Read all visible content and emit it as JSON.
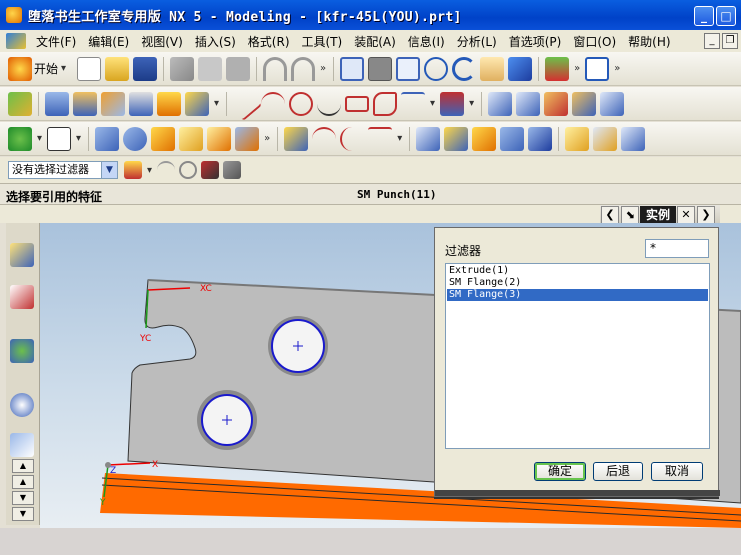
{
  "window": {
    "title": "堕落书生工作室专用版 NX 5 - Modeling - [kfr-45L(YOU).prt]",
    "min_label": "_",
    "max_label": "□",
    "close_label": "✕"
  },
  "menu": {
    "items": [
      "文件(F)",
      "编辑(E)",
      "视图(V)",
      "插入(S)",
      "格式(R)",
      "工具(T)",
      "装配(A)",
      "信息(I)",
      "分析(L)",
      "首选项(P)",
      "窗口(O)",
      "帮助(H)"
    ],
    "doc_min": "_",
    "doc_restore": "❐"
  },
  "toolbar": {
    "start_label": "开始"
  },
  "filter": {
    "select_value": "没有选择过滤器"
  },
  "status": {
    "prompt": "选择要引用的特征",
    "status_text": "SM Punch(11)"
  },
  "resource_bar": {
    "title": "实例",
    "prev": "❮",
    "next": "❯",
    "close": "✕"
  },
  "viewport": {
    "axis_labels": {
      "xc": "XC",
      "yc": "YC",
      "x": "X",
      "y": "Y",
      "z": "Z"
    }
  },
  "dialog": {
    "filter_label": "过滤器",
    "filter_value": "*",
    "items": [
      {
        "label": "Extrude(1)",
        "selected": false
      },
      {
        "label": "SM Flange(2)",
        "selected": false
      },
      {
        "label": "SM Flange(3)",
        "selected": true
      }
    ],
    "ok": "确定",
    "back": "后退",
    "cancel": "取消"
  },
  "colors": {
    "titlebar": "#0042c8",
    "selection": "#316ac5",
    "flange": "#ff6a00",
    "part": "#bfbfbf"
  }
}
